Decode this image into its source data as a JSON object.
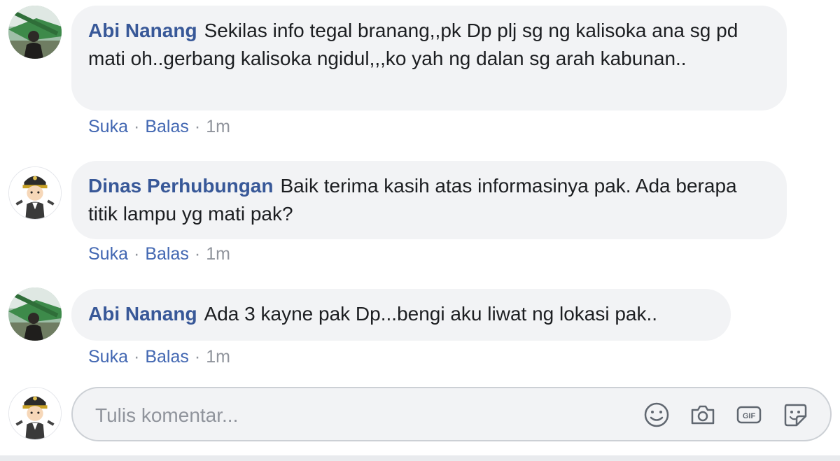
{
  "comments": [
    {
      "author": "Abi Nanang",
      "text": "Sekilas info tegal branang,,pk Dp plj sg ng kalisoka ana sg pd mati oh..gerbang kalisoka ngidul,,,ko yah ng dalan sg arah kabunan..",
      "like_label": "Suka",
      "reply_label": "Balas",
      "time": "1m",
      "avatar": "profile-photo-icon"
    },
    {
      "author": "Dinas Perhubungan",
      "text": "Baik terima kasih atas informasinya pak. Ada berapa titik lampu yg mati pak?",
      "like_label": "Suka",
      "reply_label": "Balas",
      "time": "1m",
      "avatar": "officer-avatar-icon"
    },
    {
      "author": "Abi Nanang",
      "text": "Ada 3 kayne pak Dp...bengi aku liwat ng lokasi pak..",
      "like_label": "Suka",
      "reply_label": "Balas",
      "time": "1m",
      "avatar": "profile-photo-icon"
    }
  ],
  "composer": {
    "placeholder": "Tulis komentar...",
    "icons": [
      "emoji-icon",
      "camera-icon",
      "gif-icon",
      "sticker-icon"
    ]
  },
  "colors": {
    "author": "#385898",
    "action": "#4267b2",
    "bubble": "#f2f3f5",
    "muted": "#90949c"
  }
}
